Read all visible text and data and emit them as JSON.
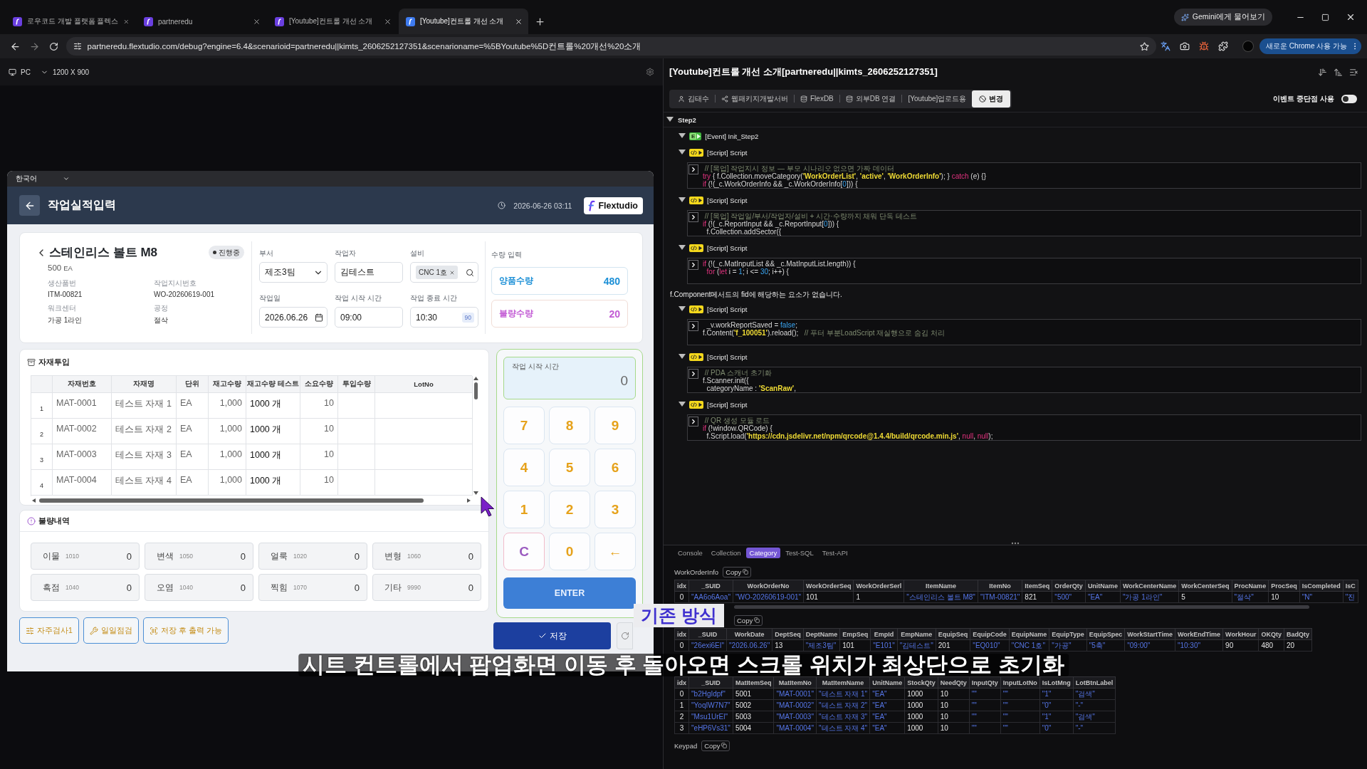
{
  "browser": {
    "tabs": [
      {
        "title": "로우코드 개발 플랫폼 플렉스",
        "selected": false
      },
      {
        "title": "partneredu",
        "selected": false
      },
      {
        "title": "[Youtube]컨트롤 개선 소개",
        "selected": false
      },
      {
        "title": "[Youtube]컨트롤 개선 소개",
        "selected": true
      }
    ],
    "assistant_button": "Gemini에게 물어보기",
    "url": "partneredu.flextudio.com/debug?engine=6.4&scenarioid=partneredu||kimts_2606252127351&scenarioname=%5BYoutube%5D컨트롤%20개선%20소개",
    "update_button": "새로운 Chrome 사용 가능"
  },
  "device_bar": {
    "device": "PC",
    "resolution": "1200 X 900"
  },
  "preview": {
    "language": "한국어",
    "header": {
      "title": "작업실적입력",
      "datetime": "2026-06-26 03:11",
      "logo": "Flextudio"
    },
    "work_order": {
      "title": "스테인리스 볼트 M8",
      "status": "진행중",
      "quantity": "500",
      "unit": "EA",
      "details": [
        {
          "label": "생산품번",
          "value": "ITM-00821"
        },
        {
          "label": "작업지시번호",
          "value": "WO-20260619-001"
        },
        {
          "label": "워크센터",
          "value": "가공 1라인"
        },
        {
          "label": "공정",
          "value": "절삭"
        }
      ]
    },
    "fields": [
      {
        "label": "부서",
        "kind": "select",
        "value": "제조3팀"
      },
      {
        "label": "작업자",
        "kind": "text",
        "value": "김테스트"
      },
      {
        "label": "설비",
        "kind": "tags",
        "value": "CNC 1호"
      },
      {
        "label": "작업일",
        "kind": "date",
        "value": "2026.06.26"
      },
      {
        "label": "작업 시작 시간",
        "kind": "text",
        "value": "09:00"
      },
      {
        "label": "작업 종료 시간",
        "kind": "duration",
        "value": "10:30",
        "badge": "90"
      }
    ],
    "quantity": {
      "title": "수량 입력",
      "items": [
        {
          "label": "양품수량",
          "value": "480",
          "kind": "good"
        },
        {
          "label": "불량수량",
          "value": "20",
          "kind": "bad"
        }
      ]
    },
    "materials": {
      "title": "자재투입",
      "columns": [
        {
          "label": "자재번호",
          "kind": "text"
        },
        {
          "label": "자재명",
          "kind": "text"
        },
        {
          "label": "단위",
          "kind": "text"
        },
        {
          "label": "재고수량",
          "kind": "number"
        },
        {
          "label": "재고수량 테스트",
          "kind": "accent"
        },
        {
          "label": "소요수량",
          "kind": "number"
        },
        {
          "label": "투입수량",
          "kind": "number"
        },
        {
          "label": "LotNo",
          "kind": "text"
        }
      ],
      "rows": [
        {
          "no": "1",
          "cells": [
            "MAT-0001",
            "테스트 자재 1",
            "EA",
            "1,000",
            "1000 개",
            "10"
          ]
        },
        {
          "no": "2",
          "cells": [
            "MAT-0002",
            "테스트 자재 2",
            "EA",
            "1,000",
            "1000 개",
            "10"
          ]
        },
        {
          "no": "3",
          "cells": [
            "MAT-0003",
            "테스트 자재 3",
            "EA",
            "1,000",
            "1000 개",
            "10"
          ]
        },
        {
          "no": "4",
          "cells": [
            "MAT-0004",
            "테스트 자재 4",
            "EA",
            "1,000",
            "1000 개",
            "10"
          ]
        }
      ]
    },
    "defects": {
      "title": "불량내역",
      "items": [
        {
          "label": "이물",
          "code": "1010",
          "value": "0"
        },
        {
          "label": "변색",
          "code": "1050",
          "value": "0"
        },
        {
          "label": "얼룩",
          "code": "1020",
          "value": "0"
        },
        {
          "label": "변형",
          "code": "1060",
          "value": "0"
        },
        {
          "label": "흑점",
          "code": "1040",
          "value": "0"
        },
        {
          "label": "오염",
          "code": "1040",
          "value": "0"
        },
        {
          "label": "찍힘",
          "code": "1070",
          "value": "0"
        },
        {
          "label": "기타",
          "code": "9990",
          "value": "0"
        }
      ]
    },
    "actions": [
      "자주검사1",
      "일일점검",
      "저장 후 출력 가능"
    ],
    "keypad": {
      "label": "작업 시작 시간",
      "display": "0",
      "keys": [
        {
          "text": "7",
          "kind": "digit"
        },
        {
          "text": "8",
          "kind": "digit"
        },
        {
          "text": "9",
          "kind": "digit"
        },
        {
          "text": "4",
          "kind": "digit"
        },
        {
          "text": "5",
          "kind": "digit"
        },
        {
          "text": "6",
          "kind": "digit"
        },
        {
          "text": "1",
          "kind": "digit"
        },
        {
          "text": "2",
          "kind": "digit"
        },
        {
          "text": "3",
          "kind": "digit"
        },
        {
          "text": "C",
          "kind": "clear"
        },
        {
          "text": "0",
          "kind": "digit"
        },
        {
          "text": "←",
          "kind": "back"
        }
      ],
      "enter": "ENTER"
    },
    "save_button": "저장"
  },
  "debugger": {
    "title": "[Youtube]컨트롤 개선 소개[partneredu||kimts_2606252127351]",
    "toolbar": [
      {
        "label": "김태수",
        "selected": false
      },
      {
        "label": "웹패키지개발서버",
        "selected": false
      },
      {
        "label": "FlexDB",
        "selected": false
      },
      {
        "label": "외부DB 연결",
        "selected": false
      },
      {
        "label": "[Youtube]업로드용",
        "selected": false
      },
      {
        "label": "변경",
        "selected": true
      }
    ],
    "breakpoint": {
      "label": "이벤트 중단점 사용",
      "on": false
    },
    "tree": {
      "label": "Step2",
      "expanded": true,
      "children": [
        {
          "kind": "event",
          "badge": "E",
          "label": "[Event] Init_Step2",
          "expanded": true
        },
        {
          "kind": "script",
          "label": "[Script] Script",
          "expanded": true,
          "code": [
            [
              {
                "kind": "comment",
                "text": " // [목업] 작업지시 정보 — 부모 시나리오 없으면 가짜 데이터"
              }
            ],
            [
              {
                "kind": "keyword",
                "text": "try"
              },
              {
                "kind": "plain",
                "text": " { f.Collection.moveCategory("
              },
              {
                "kind": "string",
                "text": "'WorkOrderList'"
              },
              {
                "kind": "plain",
                "text": ", "
              },
              {
                "kind": "string",
                "text": "'active'"
              },
              {
                "kind": "plain",
                "text": ", "
              },
              {
                "kind": "string",
                "text": "'WorkOrderInfo'"
              },
              {
                "kind": "plain",
                "text": "); } "
              },
              {
                "kind": "keyword",
                "text": "catch"
              },
              {
                "kind": "plain",
                "text": " (e) {}"
              }
            ],
            [
              {
                "kind": "keyword",
                "text": "if"
              },
              {
                "kind": "plain",
                "text": " (!(_c.WorkOrderInfo && _c.WorkOrderInfo["
              },
              {
                "kind": "literal",
                "text": "0"
              },
              {
                "kind": "plain",
                "text": "])) {"
              }
            ]
          ]
        },
        {
          "kind": "script",
          "label": "[Script] Script",
          "expanded": true,
          "code": [
            [
              {
                "kind": "comment",
                "text": " // [목업] 작업일/부서/작업자/설비 + 시간·수량까지 채워 단독 테스트"
              }
            ],
            [
              {
                "kind": "keyword",
                "text": "if"
              },
              {
                "kind": "plain",
                "text": " (!(_c.ReportInput && _c.ReportInput["
              },
              {
                "kind": "literal",
                "text": "0"
              },
              {
                "kind": "plain",
                "text": "])) {"
              }
            ],
            [
              {
                "kind": "plain",
                "text": "  f.Collection.addSector({"
              }
            ]
          ]
        },
        {
          "kind": "script",
          "label": "[Script] Script",
          "expanded": true,
          "code": [
            [
              {
                "kind": "keyword",
                "text": "if"
              },
              {
                "kind": "plain",
                "text": " (!(_c.MatInputList && _c.MatInputList.length)) {"
              }
            ],
            [
              {
                "kind": "keyword",
                "text": "  for"
              },
              {
                "kind": "plain",
                "text": " ("
              },
              {
                "kind": "keyword",
                "text": "let"
              },
              {
                "kind": "plain",
                "text": " i = "
              },
              {
                "kind": "literal",
                "text": "1"
              },
              {
                "kind": "plain",
                "text": "; i <= "
              },
              {
                "kind": "literal",
                "text": "30"
              },
              {
                "kind": "plain",
                "text": "; i++) {"
              }
            ]
          ]
        },
        {
          "kind": "message",
          "label": "f.Component메서드의 fid에 해당하는 요소가 없습니다."
        },
        {
          "kind": "script",
          "label": "[Script] Script",
          "expanded": true,
          "code": [
            [
              {
                "kind": "plain",
                "text": "  _v.workReportSaved = "
              },
              {
                "kind": "literal",
                "text": "false"
              },
              {
                "kind": "plain",
                "text": ";"
              }
            ],
            [
              {
                "kind": "plain",
                "text": "f.Content("
              },
              {
                "kind": "string",
                "text": "'f_100051'"
              },
              {
                "kind": "plain",
                "text": ").reload();   "
              },
              {
                "kind": "comment",
                "text": "// 푸터 부분LoadScript 재실행으로 숨김 처리"
              }
            ]
          ]
        },
        {
          "kind": "script",
          "label": "[Script] Script",
          "expanded": true,
          "code": [
            [
              {
                "kind": "comment",
                "text": " // PDA 스캐너 초기화"
              }
            ],
            [
              {
                "kind": "plain",
                "text": "f.Scanner.init({"
              }
            ],
            [
              {
                "kind": "plain",
                "text": "  categoryName : "
              },
              {
                "kind": "string",
                "text": "'ScanRaw'"
              },
              {
                "kind": "plain",
                "text": ","
              }
            ]
          ]
        },
        {
          "kind": "script",
          "label": "[Script] Script",
          "expanded": true,
          "code": [
            [
              {
                "kind": "comment",
                "text": " // QR 생성 모듈 로드"
              }
            ],
            [
              {
                "kind": "keyword",
                "text": "if"
              },
              {
                "kind": "plain",
                "text": " (!window.QRCode) {"
              }
            ],
            [
              {
                "kind": "plain",
                "text": "  f.Script.load("
              },
              {
                "kind": "string",
                "text": "'https://cdn.jsdelivr.net/npm/qrcode@1.4.4/build/qrcode.min.js'"
              },
              {
                "kind": "plain",
                "text": ", "
              },
              {
                "kind": "keyword",
                "text": "null"
              },
              {
                "kind": "plain",
                "text": ", "
              },
              {
                "kind": "keyword",
                "text": "null"
              },
              {
                "kind": "plain",
                "text": ");"
              }
            ]
          ]
        }
      ]
    },
    "console": {
      "tabs": [
        {
          "label": "Console",
          "selected": false
        },
        {
          "label": "Collection",
          "selected": false
        },
        {
          "label": "Category",
          "selected": true
        },
        {
          "label": "Test-SQL",
          "selected": false
        },
        {
          "label": "Test-API",
          "selected": false
        }
      ],
      "tables": [
        {
          "label": "WorkOrderInfo",
          "copy": "Copy",
          "columns": [
            {
              "label": "idx",
              "kind": "num"
            },
            {
              "label": "_SUID",
              "kind": "str"
            },
            {
              "label": "WorkOrderNo",
              "kind": "str"
            },
            {
              "label": "WorkOrderSeq",
              "kind": "num"
            },
            {
              "label": "WorkOrderSerl",
              "kind": "num"
            },
            {
              "label": "ItemName",
              "kind": "str"
            },
            {
              "label": "ItemNo",
              "kind": "str"
            },
            {
              "label": "ItemSeq",
              "kind": "num"
            },
            {
              "label": "OrderQty",
              "kind": "str"
            },
            {
              "label": "UnitName",
              "kind": "str"
            },
            {
              "label": "WorkCenterName",
              "kind": "str"
            },
            {
              "label": "WorkCenterSeq",
              "kind": "num"
            },
            {
              "label": "ProcName",
              "kind": "str"
            },
            {
              "label": "ProcSeq",
              "kind": "num"
            },
            {
              "label": "IsCompleted",
              "kind": "str"
            },
            {
              "label": "IsC",
              "kind": "str"
            }
          ],
          "rows": [
            [
              "0",
              "\"AA6o6Aoa\"",
              "\"WO-20260619-001\"",
              "101",
              "1",
              "\"스테인리스 볼트 M8\"",
              "\"ITM-00821\"",
              "821",
              "\"500\"",
              "\"EA\"",
              "\"가공 1라인\"",
              "5",
              "\"절삭\"",
              "10",
              "\"N\"",
              "\"진"
            ]
          ]
        },
        {
          "copy": "Copy",
          "columns": [
            {
              "label": "idx",
              "kind": "num"
            },
            {
              "label": "_SUID",
              "kind": "str"
            },
            {
              "label": "WorkDate",
              "kind": "str"
            },
            {
              "label": "DeptSeq",
              "kind": "num"
            },
            {
              "label": "DeptName",
              "kind": "str"
            },
            {
              "label": "EmpSeq",
              "kind": "num"
            },
            {
              "label": "EmpId",
              "kind": "str"
            },
            {
              "label": "EmpName",
              "kind": "str"
            },
            {
              "label": "EquipSeq",
              "kind": "num"
            },
            {
              "label": "EquipCode",
              "kind": "str"
            },
            {
              "label": "EquipName",
              "kind": "str"
            },
            {
              "label": "EquipType",
              "kind": "str"
            },
            {
              "label": "EquipSpec",
              "kind": "str"
            },
            {
              "label": "WorkStartTime",
              "kind": "str"
            },
            {
              "label": "WorkEndTime",
              "kind": "str"
            },
            {
              "label": "WorkHour",
              "kind": "num"
            },
            {
              "label": "OKQty",
              "kind": "num"
            },
            {
              "label": "BadQty",
              "kind": "num"
            }
          ],
          "rows": [
            [
              "0",
              "\"26exi6EI\"",
              "\"2026.06.26\"",
              "13",
              "\"제조3팀\"",
              "101",
              "\"E101\"",
              "\"김테스트\"",
              "201",
              "\"EQ010\"",
              "\"CNC 1호\"",
              "\"가공\"",
              "\"5축\"",
              "\"09:00\"",
              "\"10:30\"",
              "90",
              "480",
              "20"
            ]
          ]
        },
        {
          "columns": [
            {
              "label": "idx",
              "kind": "num"
            },
            {
              "label": "_SUID",
              "kind": "str"
            },
            {
              "label": "MatItemSeq",
              "kind": "num"
            },
            {
              "label": "MatItemNo",
              "kind": "str"
            },
            {
              "label": "MatItemName",
              "kind": "str"
            },
            {
              "label": "UnitName",
              "kind": "str"
            },
            {
              "label": "StockQty",
              "kind": "num"
            },
            {
              "label": "NeedQty",
              "kind": "num"
            },
            {
              "label": "InputQty",
              "kind": "str"
            },
            {
              "label": "InputLotNo",
              "kind": "str"
            },
            {
              "label": "IsLotMng",
              "kind": "str"
            },
            {
              "label": "LotBtnLabel",
              "kind": "str"
            }
          ],
          "rows": [
            [
              "0",
              "\"b2HgIdpf\"",
              "5001",
              "\"MAT-0001\"",
              "\"테스트 자재 1\"",
              "\"EA\"",
              "1000",
              "10",
              "\"\"",
              "\"\"",
              "\"1\"",
              "\"검색\""
            ],
            [
              "1",
              "\"YoqIW7N7\"",
              "5002",
              "\"MAT-0002\"",
              "\"테스트 자재 2\"",
              "\"EA\"",
              "1000",
              "10",
              "\"\"",
              "\"\"",
              "\"0\"",
              "\"-\""
            ],
            [
              "2",
              "\"Msu1UrEl\"",
              "5003",
              "\"MAT-0003\"",
              "\"테스트 자재 3\"",
              "\"EA\"",
              "1000",
              "10",
              "\"\"",
              "\"\"",
              "\"1\"",
              "\"검색\""
            ],
            [
              "3",
              "\"eHP6Vs31\"",
              "5004",
              "\"MAT-0004\"",
              "\"테스트 자재 4\"",
              "\"EA\"",
              "1000",
              "10",
              "\"\"",
              "\"\"",
              "\"0\"",
              "\"-\""
            ]
          ]
        }
      ],
      "footer": {
        "label": "Keypad",
        "copy": "Copy"
      }
    }
  },
  "caption": {
    "tag": "기존 방식",
    "text": "시트 컨트롤에서 팝업화면 이동 후 돌아오면 스크롤 위치가 최상단으로 초기화"
  }
}
